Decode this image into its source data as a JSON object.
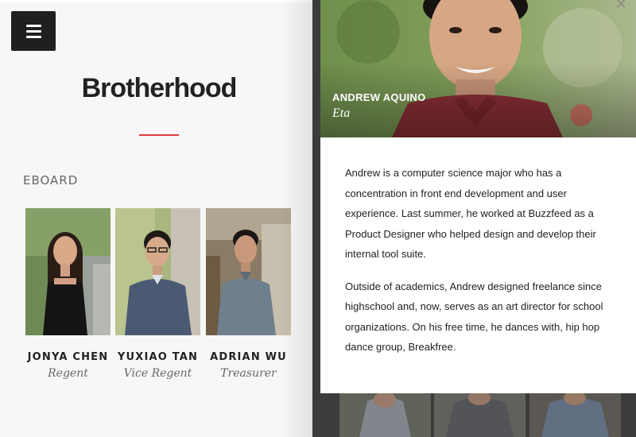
{
  "page": {
    "title": "Brotherhood",
    "section_label": "EBOARD",
    "accent_color": "#e0393e"
  },
  "menu": {
    "icon": "hamburger-menu-icon"
  },
  "members": [
    {
      "name": "JONYA CHEN",
      "role": "Regent"
    },
    {
      "name": "YUXIAO TAN",
      "role": "Vice Regent"
    },
    {
      "name": "ADRIAN WU",
      "role": "Treasurer"
    }
  ],
  "profile": {
    "name": "ANDREW AQUINO",
    "role": "Eta",
    "close_icon": "close-icon",
    "close_glyph": "×",
    "bio": [
      "Andrew is a computer science major who has a concentration in front end development and user experience. Last summer, he worked at Buzzfeed as a Product Designer who helped design and develop their internal tool suite.",
      "Outside of academics, Andrew designed freelance since highschool and, now, serves as an art director for school organizations. On his free time, he dances with, hip hop dance group, Breakfree."
    ]
  }
}
